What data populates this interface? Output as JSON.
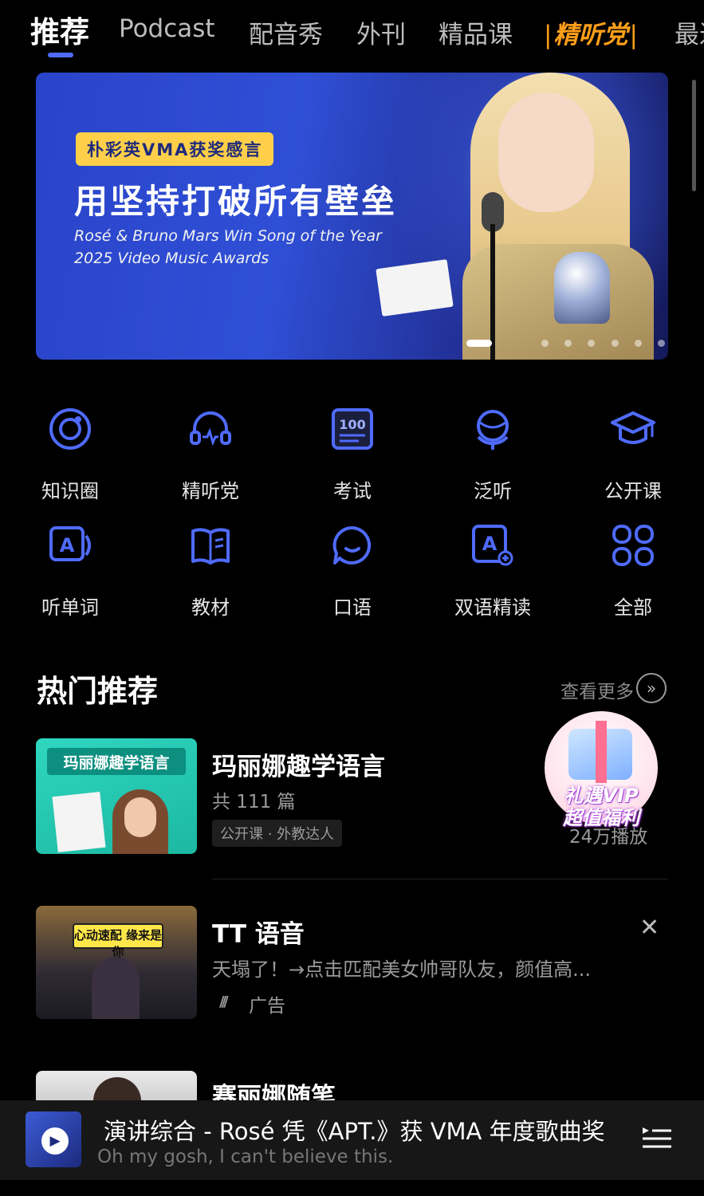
{
  "tabs": [
    {
      "label": "推荐",
      "active": true
    },
    {
      "label": "Podcast"
    },
    {
      "label": "配音秀"
    },
    {
      "label": "外刊"
    },
    {
      "label": "精品课"
    },
    {
      "label": "精听党"
    },
    {
      "label": "最近"
    }
  ],
  "banner": {
    "tag": "朴彩英VMA获奖感言",
    "title": "用坚持打破所有壁垒",
    "subtitle_line1": "Rosé & Bruno Mars Win Song of the Year",
    "subtitle_line2": "2025 Video Music Awards",
    "page_count": 7,
    "active_page": 1
  },
  "categories": [
    {
      "label": "知识圈",
      "icon": "knowledge-circle-icon"
    },
    {
      "label": "精听党",
      "icon": "headphones-icon"
    },
    {
      "label": "考试",
      "icon": "exam-100-icon"
    },
    {
      "label": "泛听",
      "icon": "globe-icon"
    },
    {
      "label": "公开课",
      "icon": "graduation-cap-icon"
    },
    {
      "label": "听单词",
      "icon": "word-card-icon"
    },
    {
      "label": "教材",
      "icon": "book-icon"
    },
    {
      "label": "口语",
      "icon": "chat-bubble-icon"
    },
    {
      "label": "双语精读",
      "icon": "bilingual-reading-icon"
    },
    {
      "label": "全部",
      "icon": "grid-all-icon"
    }
  ],
  "section": {
    "title": "热门推荐",
    "more_label": "查看更多"
  },
  "items": [
    {
      "title": "玛丽娜趣学语言",
      "count": "共 111 篇",
      "tag": "公开课 · 外教达人",
      "plays": "24万播放",
      "thumb_text": "玛丽娜趣学语言"
    },
    {
      "title": "TT 语音",
      "desc": "天塌了！→点击匹配美女帅哥队友，颜值高...",
      "ad_label": "广告",
      "thumb_text": "心动速配 缘来是你"
    },
    {
      "title": "赛丽娜随笔"
    }
  ],
  "vip_promo": {
    "line1": "礼遇VIP",
    "line2": "超值福利"
  },
  "player": {
    "title": "演讲综合 - Rosé 凭《APT.》获 VMA 年度歌曲奖",
    "subtitle": "Oh my gosh, I can't believe this."
  },
  "colors": {
    "accent": "#4f6bff",
    "special_tab": "#ff9f1a",
    "background": "#000000"
  }
}
